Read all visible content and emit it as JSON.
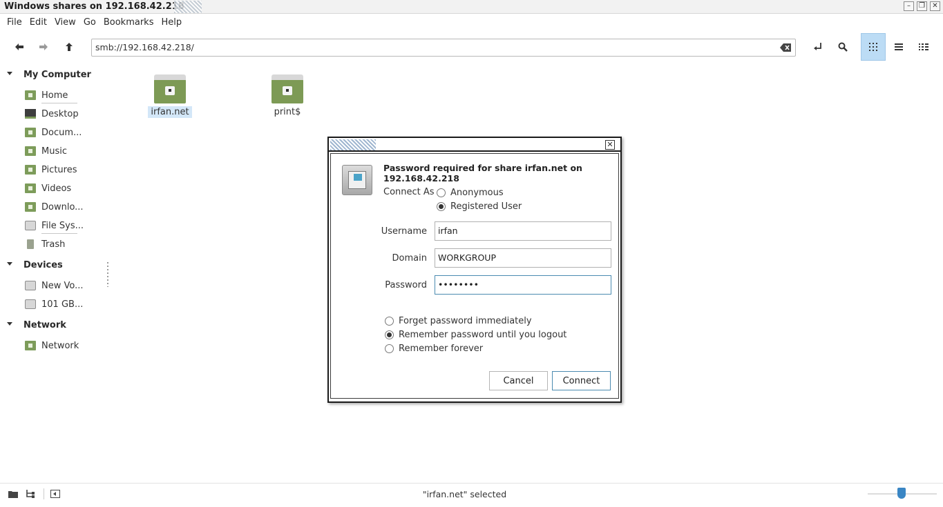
{
  "window": {
    "title": "Windows shares on 192.168.42.218",
    "buttons": [
      "minimize",
      "maximize",
      "close"
    ]
  },
  "menu": [
    "File",
    "Edit",
    "View",
    "Go",
    "Bookmarks",
    "Help"
  ],
  "toolbar": {
    "location": "smb://192.168.42.218/",
    "icons": [
      "back-icon",
      "forward-icon",
      "up-icon",
      "toggle-location-icon",
      "search-icon",
      "icon-view-icon",
      "list-view-icon",
      "compact-view-icon"
    ],
    "active_view": "icon-view"
  },
  "sidebar": {
    "my_computer": {
      "label": "My Computer",
      "items": [
        "Home",
        "Desktop",
        "Docum...",
        "Music",
        "Pictures",
        "Videos",
        "Downlo...",
        "File Sys...",
        "Trash"
      ]
    },
    "devices": {
      "label": "Devices",
      "items": [
        "New Vo...",
        "101 GB..."
      ]
    },
    "network": {
      "label": "Network",
      "items": [
        "Network"
      ]
    }
  },
  "files": [
    {
      "name": "irfan.net",
      "selected": true
    },
    {
      "name": "print$",
      "selected": false
    }
  ],
  "dialog": {
    "heading": "Password required for share irfan.net on 192.168.42.218",
    "connect_as_label": "Connect As",
    "connect_as_options": [
      "Anonymous",
      "Registered User"
    ],
    "connect_as_selected": "Registered User",
    "username_label": "Username",
    "username_value": "irfan",
    "domain_label": "Domain",
    "domain_value": "WORKGROUP",
    "password_label": "Password",
    "password_value": "••••••••",
    "remember_options": [
      "Forget password immediately",
      "Remember password until you logout",
      "Remember forever"
    ],
    "remember_selected": "Remember password until you logout",
    "cancel_label": "Cancel",
    "connect_label": "Connect"
  },
  "statusbar": {
    "message": "\"irfan.net\" selected",
    "zoom_level": 0.5
  }
}
